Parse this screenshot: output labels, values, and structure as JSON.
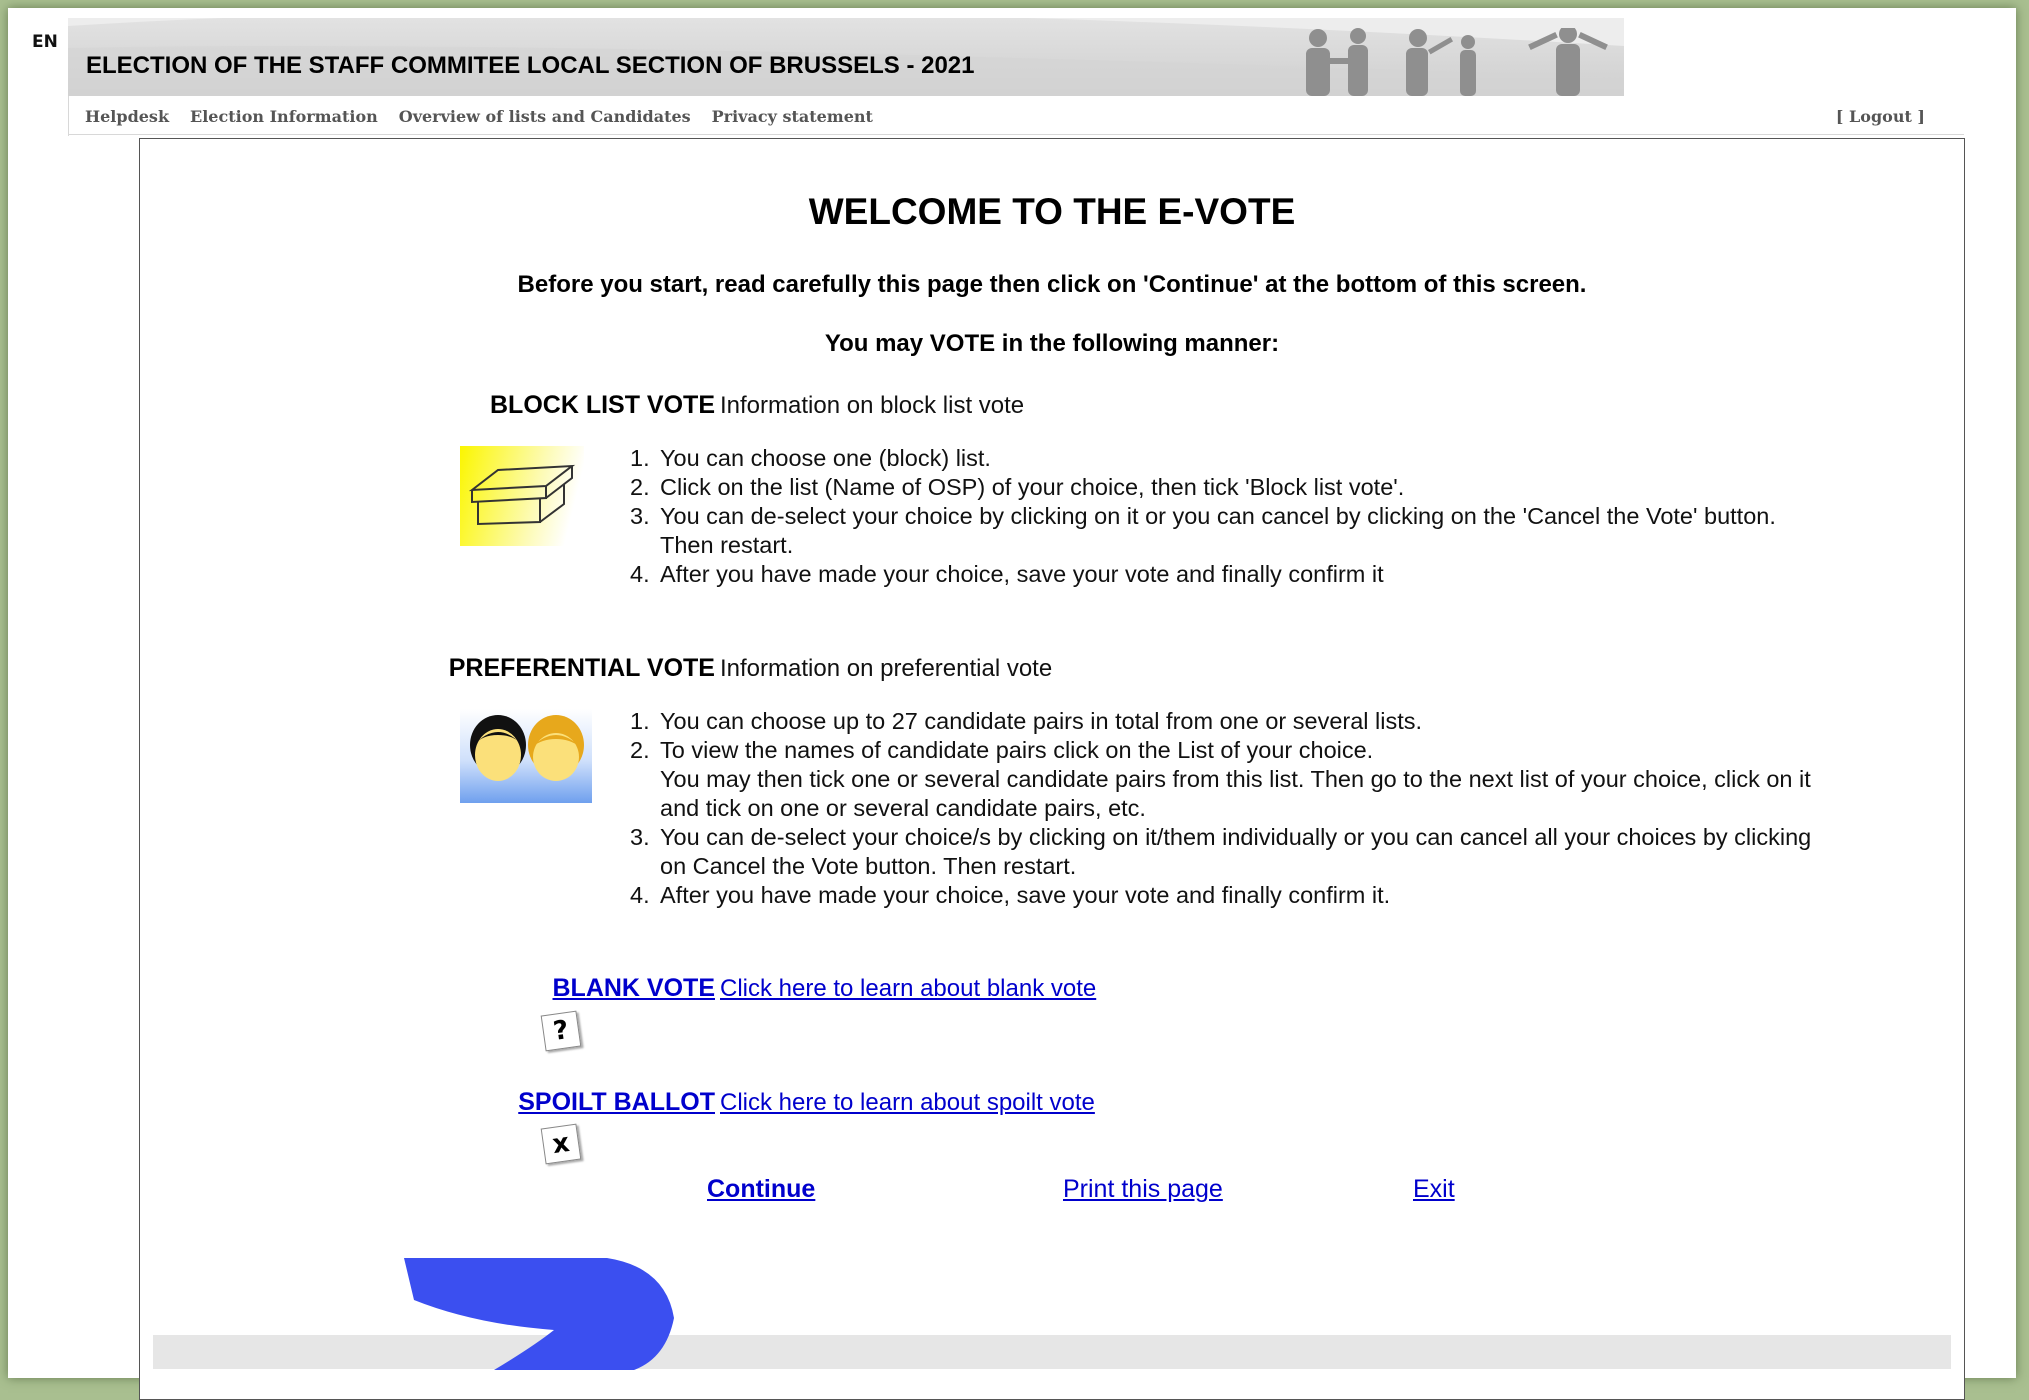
{
  "language": "EN",
  "header": {
    "title": "ELECTION OF THE STAFF COMMITEE LOCAL SECTION OF BRUSSELS - 2021"
  },
  "nav": {
    "items": [
      "Helpdesk",
      "Election Information",
      "Overview of lists and Candidates",
      "Privacy statement"
    ],
    "logout": "[ Logout ]"
  },
  "main": {
    "title": "WELCOME TO THE E-VOTE",
    "intro": "Before you start, read carefully this page then click on 'Continue' at the bottom of this screen.",
    "manner": "You may VOTE in the following manner:",
    "block": {
      "label": "BLOCK LIST VOTE",
      "info": "Information on block list vote",
      "steps": [
        "You can choose one (block) list.",
        "Click on the list (Name of OSP) of your choice, then tick 'Block list vote'.",
        "You can de-select your choice by clicking on it or you can cancel by clicking on the 'Cancel the Vote' button.",
        "After you have made your choice, save your vote and finally confirm it"
      ],
      "step3_cont": "Then restart."
    },
    "preferential": {
      "label": "PREFERENTIAL VOTE",
      "info": "Information on preferential vote",
      "steps": [
        "You can choose up to 27 candidate pairs in total from one or several lists.",
        "To view the names of candidate pairs click on the List of your choice.",
        "You can de-select your choice/s by clicking on it/them individually or you can cancel all your choices by clicking",
        "After you have made your choice, save your vote and finally confirm it."
      ],
      "step2_cont1": "You may then tick one or several candidate pairs from this list. Then go to the next list of your choice, click on it",
      "step2_cont2": "and tick on one or several candidate pairs, etc.",
      "step3_cont": "on Cancel the Vote button. Then restart."
    },
    "blank": {
      "label": "BLANK VOTE",
      "link": "Click here to learn about blank vote",
      "icon_glyph": "?"
    },
    "spoilt": {
      "label": "SPOILT BALLOT",
      "link": "Click here to learn about spoilt vote",
      "icon_glyph": "x"
    },
    "actions": {
      "continue": "Continue",
      "print": "Print this page",
      "exit": "Exit"
    }
  },
  "colors": {
    "link": "#0000cc",
    "page_background": "#a9bf90",
    "annotation_arrow": "#3b4ff0"
  }
}
